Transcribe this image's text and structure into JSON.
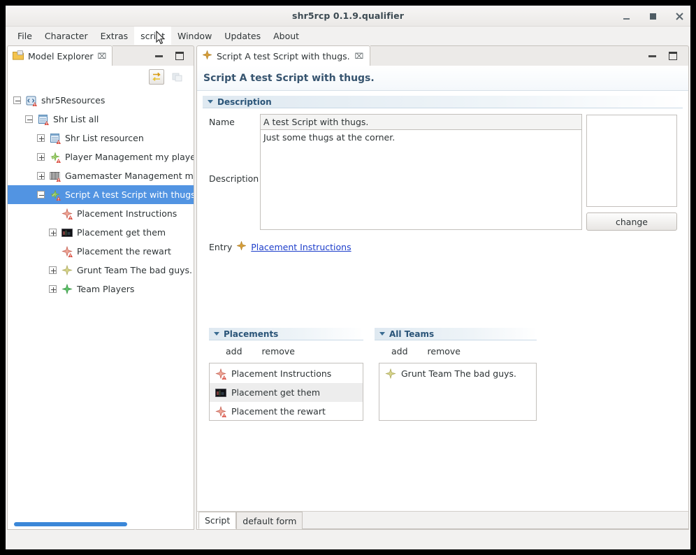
{
  "window": {
    "title": "shr5rcp 0.1.9.qualifier",
    "minimize_label": "minimize",
    "maximize_label": "maximize",
    "close_label": "close"
  },
  "menubar": {
    "items": [
      {
        "label": "File",
        "active": false
      },
      {
        "label": "Character",
        "active": false
      },
      {
        "label": "Extras",
        "active": false
      },
      {
        "label": "script",
        "active": true
      },
      {
        "label": "Window",
        "active": false
      },
      {
        "label": "Updates",
        "active": false
      },
      {
        "label": "About",
        "active": false
      }
    ]
  },
  "left_view": {
    "tab_label": "Model Explorer",
    "tab_close": "⌧",
    "toolbar": {
      "link_with_editor": "link-with-editor-icon",
      "collapse_all": "collapse-all-icon"
    },
    "tree": [
      {
        "label": "shr5Resources",
        "indent": 0,
        "twisty": "minus",
        "icon": "resources",
        "selected": false
      },
      {
        "label": "Shr List all",
        "indent": 1,
        "twisty": "minus",
        "icon": "list",
        "selected": false
      },
      {
        "label": "Shr List resourcen",
        "indent": 2,
        "twisty": "plus",
        "icon": "list",
        "selected": false
      },
      {
        "label": "Player Management my player",
        "indent": 2,
        "twisty": "plus",
        "icon": "script",
        "selected": false
      },
      {
        "label": "Gamemaster Management m",
        "indent": 2,
        "twisty": "plus",
        "icon": "gamemaster",
        "selected": false
      },
      {
        "label": "Script A test Script with thugs",
        "indent": 2,
        "twisty": "minus",
        "icon": "script",
        "selected": true
      },
      {
        "label": "Placement Instructions",
        "indent": 3,
        "twisty": "none",
        "icon": "placement",
        "selected": false
      },
      {
        "label": "Placement get them",
        "indent": 3,
        "twisty": "plus",
        "icon": "photo",
        "selected": false
      },
      {
        "label": "Placement the rewart",
        "indent": 3,
        "twisty": "none",
        "icon": "placement",
        "selected": false
      },
      {
        "label": "Grunt Team The bad guys.",
        "indent": 3,
        "twisty": "plus",
        "icon": "team-olive",
        "selected": false
      },
      {
        "label": "Team Players",
        "indent": 3,
        "twisty": "plus",
        "icon": "team-green",
        "selected": false
      }
    ],
    "scroll_thumb_percent": 66
  },
  "editor": {
    "tab_label": "Script A test Script with thugs.",
    "tab_close": "⌧",
    "form_title": "Script A test Script with thugs.",
    "description_section": {
      "title": "Description",
      "name_label": "Name",
      "name_value": "A test Script with thugs.",
      "description_label": "Description",
      "description_value": "Just some thugs at the corner.",
      "change_button": "change"
    },
    "entry": {
      "label": "Entry",
      "link": "Placement Instructions"
    },
    "placements_section": {
      "title": "Placements",
      "add_label": "add",
      "remove_label": "remove",
      "items": [
        {
          "label": "Placement Instructions",
          "icon": "placement",
          "selected": false
        },
        {
          "label": "Placement get them",
          "icon": "photo",
          "selected": true
        },
        {
          "label": "Placement the rewart",
          "icon": "placement",
          "selected": false
        }
      ]
    },
    "teams_section": {
      "title": "All Teams",
      "add_label": "add",
      "remove_label": "remove",
      "items": [
        {
          "label": "Grunt Team The bad guys.",
          "icon": "team-olive",
          "selected": false
        }
      ]
    },
    "form_tabs": [
      {
        "label": "Script",
        "active": true
      },
      {
        "label": "default form",
        "active": false
      }
    ]
  },
  "colors": {
    "selection": "#5294e2",
    "link": "#1d3ecb",
    "section_title": "#2a5478",
    "scrollbar": "#3b87d8"
  }
}
